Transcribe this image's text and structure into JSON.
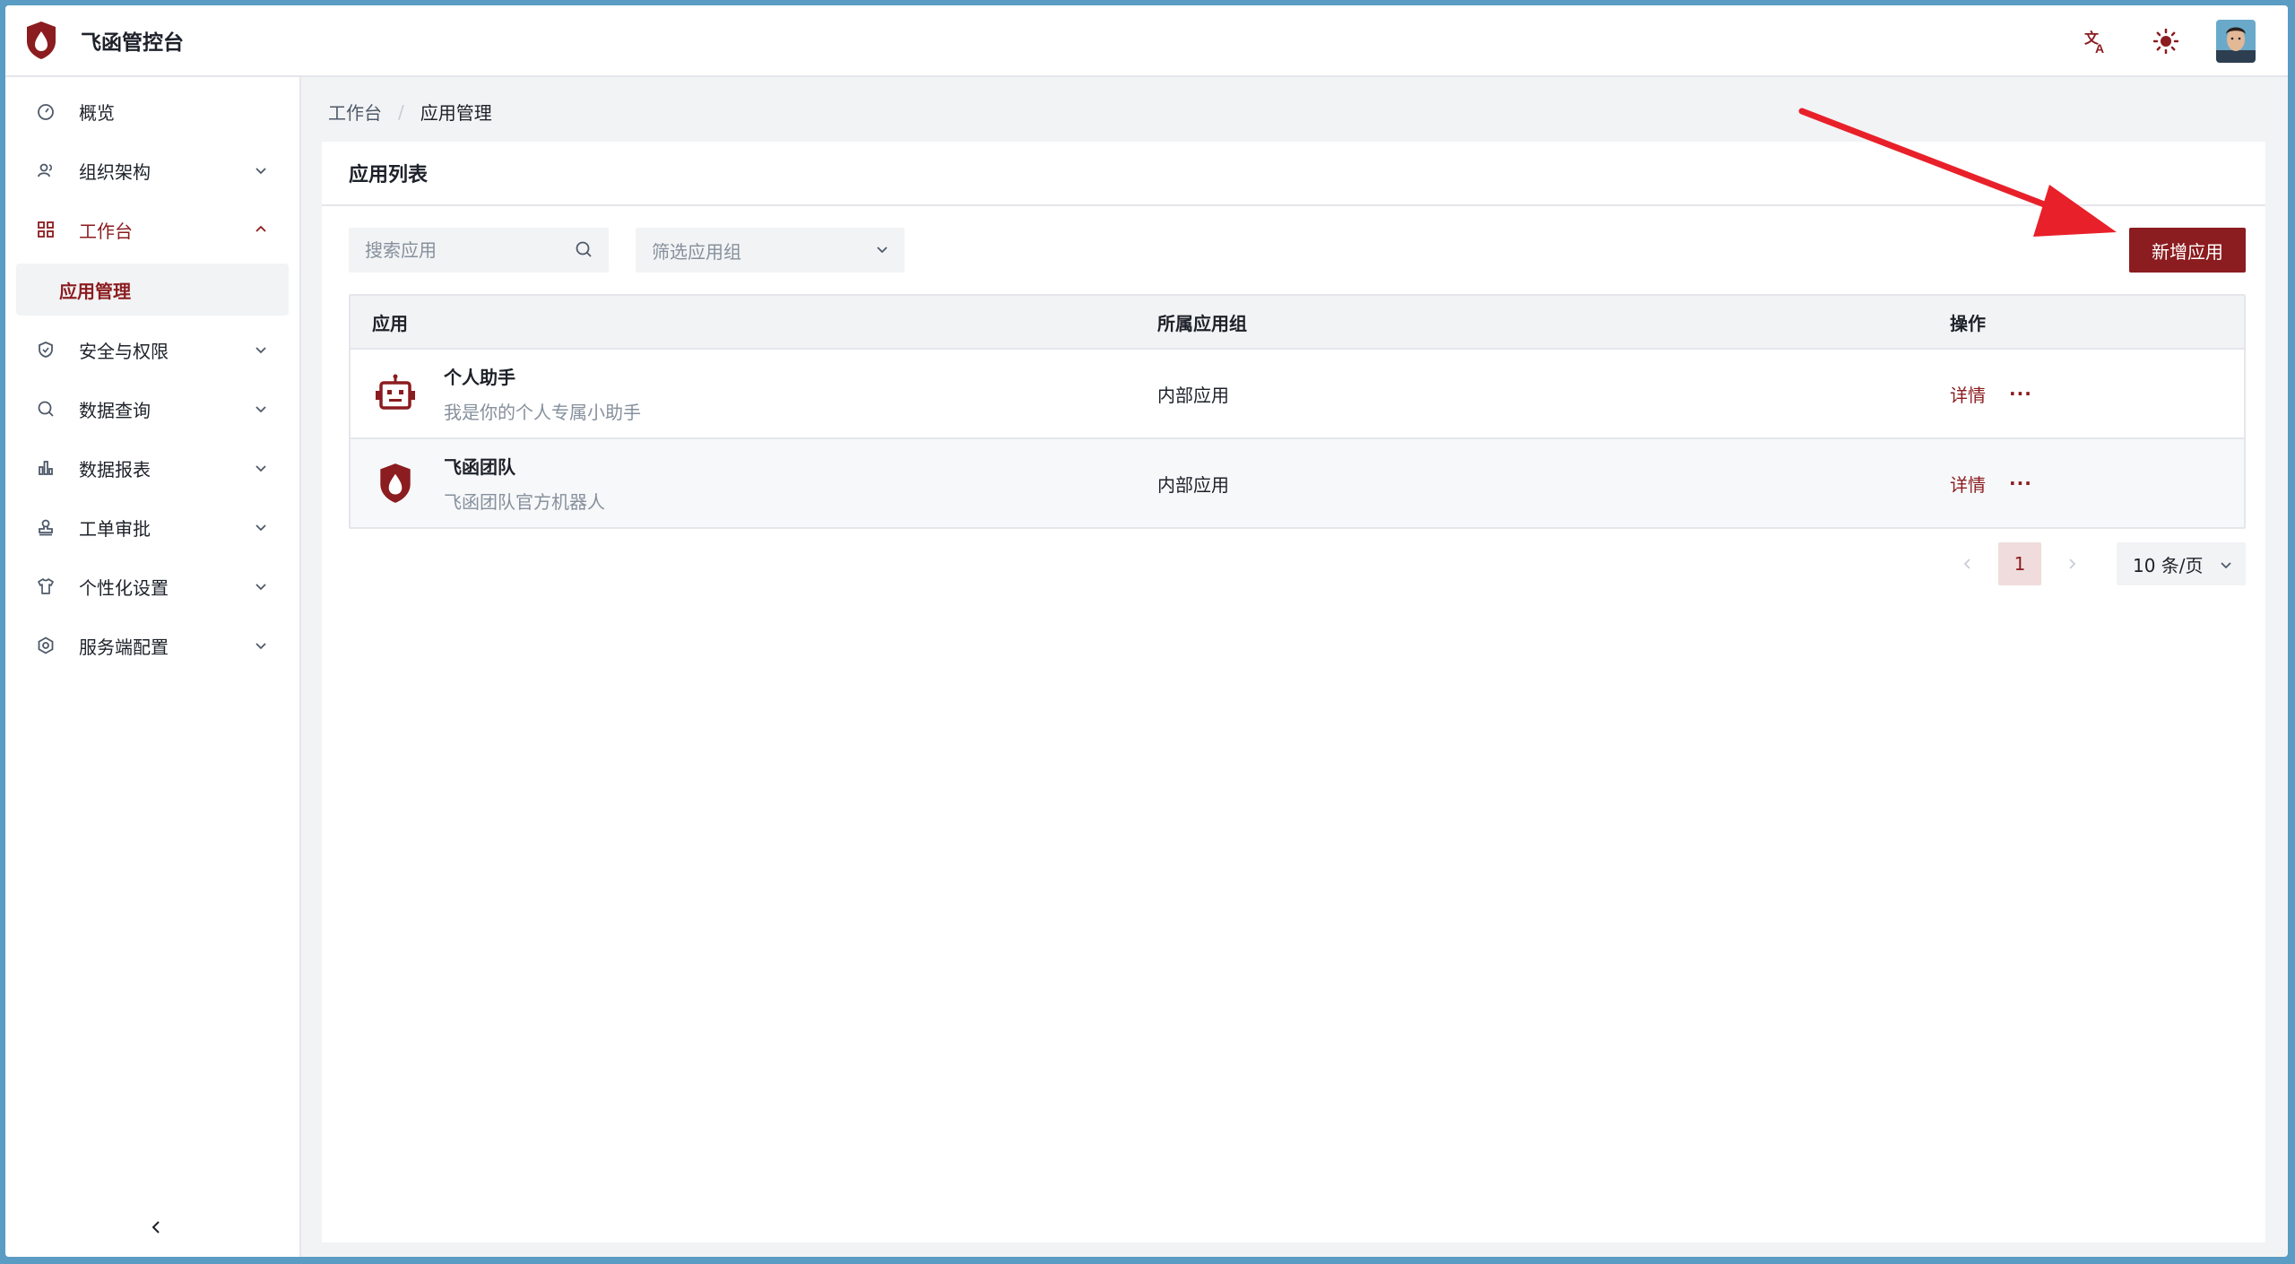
{
  "header": {
    "app_title": "飞函管控台"
  },
  "sidebar": {
    "items": [
      {
        "label": "概览",
        "icon": "dashboard-icon",
        "expandable": false
      },
      {
        "label": "组织架构",
        "icon": "org-icon",
        "expandable": true
      },
      {
        "label": "工作台",
        "icon": "grid-icon",
        "expandable": true,
        "active": true
      },
      {
        "label": "安全与权限",
        "icon": "shield-icon",
        "expandable": true
      },
      {
        "label": "数据查询",
        "icon": "search-icon",
        "expandable": true
      },
      {
        "label": "数据报表",
        "icon": "bar-chart-icon",
        "expandable": true
      },
      {
        "label": "工单审批",
        "icon": "stamp-icon",
        "expandable": true
      },
      {
        "label": "个性化设置",
        "icon": "shirt-icon",
        "expandable": true
      },
      {
        "label": "服务端配置",
        "icon": "settings-icon",
        "expandable": true
      }
    ],
    "sub_item": "应用管理"
  },
  "breadcrumb": {
    "parent": "工作台",
    "separator": "/",
    "current": "应用管理"
  },
  "card": {
    "title": "应用列表",
    "search_placeholder": "搜索应用",
    "filter_placeholder": "筛选应用组",
    "add_button": "新增应用"
  },
  "table": {
    "headers": {
      "app": "应用",
      "group": "所属应用组",
      "ops": "操作"
    },
    "rows": [
      {
        "name": "个人助手",
        "desc": "我是你的个人专属小助手",
        "group": "内部应用",
        "detail": "详情",
        "more": "···",
        "icon": "robot-icon"
      },
      {
        "name": "飞函团队",
        "desc": "飞函团队官方机器人",
        "group": "内部应用",
        "detail": "详情",
        "more": "···",
        "icon": "shield-logo-icon"
      }
    ]
  },
  "pagination": {
    "current_page": "1",
    "page_size": "10 条/页"
  },
  "colors": {
    "brand": "#8b1c1f",
    "annotation_arrow": "#e8202a"
  }
}
